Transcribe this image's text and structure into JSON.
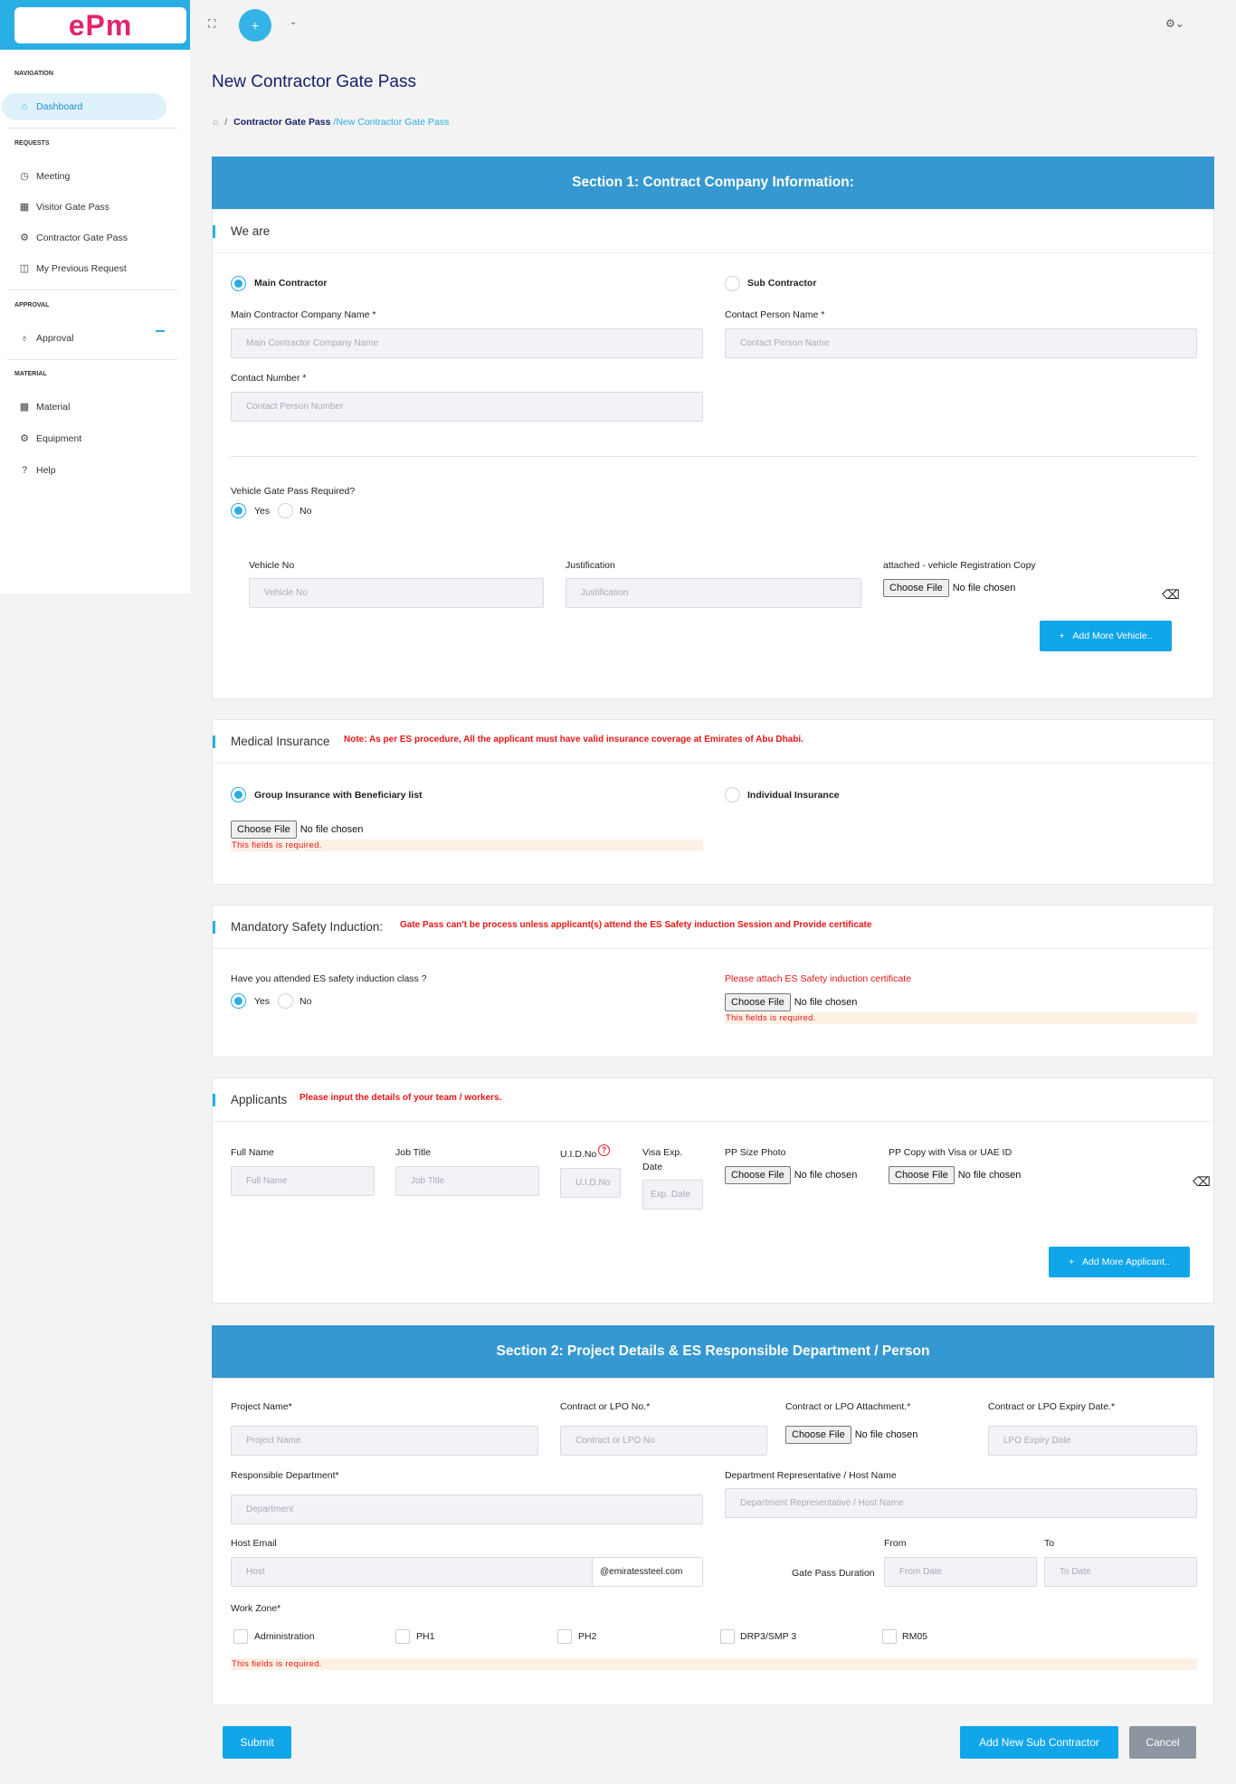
{
  "app": {
    "logo": "ePm"
  },
  "sidebar": {
    "sections": {
      "navigation": "NAVIGATION",
      "requests": "REQUESTS",
      "approval": "APPROVAL",
      "material": "MATERIAL"
    },
    "items": {
      "dashboard": "Dashboard",
      "meeting": "Meeting",
      "visitor": "Visitor Gate Pass",
      "contractor": "Contractor Gate Pass",
      "previous": "My Previous Request",
      "approval": "Approval",
      "material": "Material",
      "equipment": "Equipment",
      "help": "Help"
    }
  },
  "topbar": {
    "add_label": "+"
  },
  "page": {
    "title": "New Contractor Gate Pass",
    "breadcrumb": {
      "parent": "Contractor Gate Pass",
      "current": "New Contractor Gate Pass"
    }
  },
  "section1": {
    "banner": "Section 1: Contract Company Information:",
    "we_are": "We are",
    "main_contractor": "Main Contractor",
    "sub_contractor": "Sub Contractor",
    "company_label": "Main Contractor Company Name *",
    "company_placeholder": "Main Contractor Company Name",
    "contact_person_label": "Contact Person Name *",
    "contact_person_placeholder": "Contact Person Name",
    "contact_number_label": "Contact Number *",
    "contact_number_placeholder": "Contact Person Number",
    "vehicle_question": "Vehicle Gate Pass Required?",
    "yes": "Yes",
    "no": "No",
    "vehicle_no_label": "Vehicle No",
    "vehicle_no_placeholder": "Vehicle No",
    "justification_label": "Justification",
    "justification_placeholder": "Justification",
    "registration_label": "attached - vehicle Registration Copy",
    "add_vehicle": "Add More Vehicle..",
    "medical_title": "Medical Insurance",
    "medical_note": "Note: As per ES procedure, All the applicant must have valid insurance coverage at Emirates of Abu Dhabi.",
    "group_insurance": "Group Insurance with Beneficiary list",
    "individual_insurance": "Individual Insurance",
    "safety_title": "Mandatory Safety Induction:",
    "safety_note": "Gate Pass can't be process unless applicant(s) attend the ES Safety induction Session and Provide certificate",
    "safety_question": "Have you attended ES safety induction class ?",
    "safety_attach": "Please attach ES Safety induction certificate",
    "applicants_title": "Applicants",
    "applicants_note": "Please input the details of your team / workers.",
    "full_name_label": "Full Name",
    "full_name_placeholder": "Full Name",
    "job_title_label": "Job Title",
    "job_title_placeholder": "Job Title",
    "uid_label": "U.I.D.No",
    "uid_placeholder": "U.I.D.No",
    "visa_label_1": "Visa Exp.",
    "visa_label_2": "Date",
    "visa_placeholder": "Exp. Date",
    "photo_label": "PP Size Photo",
    "pp_copy_label": "PP Copy with Visa or UAE ID",
    "add_applicant": "Add More Applicant.."
  },
  "file": {
    "button": "Choose File",
    "status": "No file chosen"
  },
  "error": {
    "required": "This fields is required."
  },
  "section2": {
    "banner": "Section 2: Project Details & ES Responsible Department / Person",
    "project_label": "Project Name*",
    "project_placeholder": "Project Name",
    "lpo_label": "Contract or LPO No.*",
    "lpo_placeholder": "Contract or LPO No",
    "lpo_attach_label": "Contract or LPO Attachment.*",
    "lpo_expiry_label": "Contract or LPO Expiry Date.*",
    "lpo_expiry_placeholder": "LPO Expiry Date",
    "dept_label": "Responsible Department*",
    "dept_placeholder": "Department",
    "rep_label": "Department Representative / Host Name",
    "rep_placeholder": "Department Representative / Host Name",
    "host_email_label": "Host Email",
    "host_placeholder": "Host",
    "email_suffix": "@emiratessteel.com",
    "from_label": "From",
    "to_label": "To",
    "duration_label": "Gate Pass Duration",
    "from_placeholder": "From Date",
    "to_placeholder": "To Date",
    "work_zone_label": "Work Zone*",
    "zones": [
      "Administration",
      "PH1",
      "PH2",
      "DRP3/SMP 3",
      "RM05"
    ]
  },
  "footer": {
    "submit": "Submit",
    "add_sub": "Add New Sub Contractor",
    "cancel": "Cancel"
  }
}
